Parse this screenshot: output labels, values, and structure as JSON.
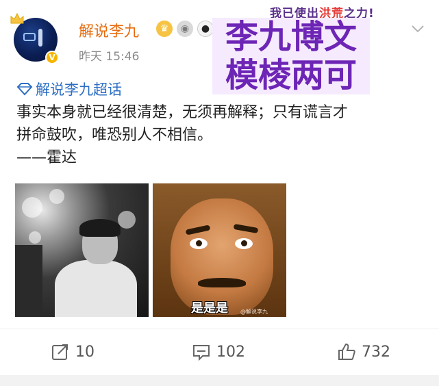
{
  "header": {
    "username": "解说李九",
    "timestamp": "昨天 15:46",
    "verified_badge": "V",
    "badges": [
      "crown-icon",
      "medal-icon",
      "panda-icon"
    ]
  },
  "overlay": {
    "top_slogan_prefix": "我已使出",
    "top_slogan_highlight": "洪荒",
    "top_slogan_suffix": "之力!",
    "title_line1": "李九博文",
    "title_line2": "模棱两可"
  },
  "post": {
    "super_topic": "解说李九超话",
    "lines": [
      "事实本身就已经很清楚，无须再解释；只有谎言才",
      "拼命鼓吹，唯恐别人不相信。",
      "——霍达"
    ],
    "images": [
      {
        "alt": "black-and-white photo of a man looking up"
      },
      {
        "alt": "meme face",
        "caption": "是是是",
        "watermark": "@解说李九"
      }
    ]
  },
  "actions": {
    "repost_count": "10",
    "comment_count": "102",
    "like_count": "732"
  },
  "colors": {
    "username": "#e86b0c",
    "topic_link": "#2c6ec4",
    "overlay_title": "#6d25b5"
  }
}
